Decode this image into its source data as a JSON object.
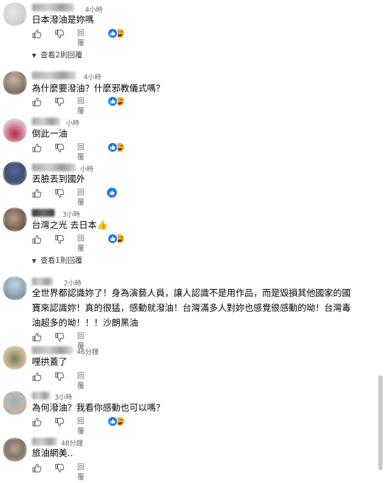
{
  "labels": {
    "reply": "回覆"
  },
  "comments": [
    {
      "time": "4小時",
      "text": "日本潑油是妳嗎"
    },
    {
      "time": "4小時",
      "text": "為什麼要潑油？什麼邪教儀式嗎？"
    },
    {
      "time": "小時",
      "text": "倒此一油"
    },
    {
      "time": "小時",
      "text": "丟臉丟到國外"
    },
    {
      "time": "3小時",
      "text": "台灣之光 去日本👍"
    },
    {
      "time": "2小時",
      "text_lines": [
        "全世界都認識妳了！身為演藝人員，讓人認識不是用作品，而是毀損其他國家的國",
        "寶來認識妳！真的很猛，感動就潑油！台灣滿多人對妳也感覺很感動的呦！台灣毒",
        "油超多的呦！！！沙朗黑油"
      ]
    },
    {
      "time": "46分鐘",
      "text": "哩拱蓋了"
    },
    {
      "time": "3小時",
      "text": "為何潑油？我看你感動也可以嗎？"
    },
    {
      "time": "48分鐘",
      "text": "旅油網美.."
    }
  ],
  "more_replies": [
    {
      "label": "查看2則回覆"
    },
    {
      "label": "查看1則回覆"
    }
  ],
  "colors": {
    "like_blue": "#1877f2",
    "haha_yellow": "#f7b125",
    "secondary_text": "#65676b"
  },
  "icons": {
    "like": "thumbs-up-icon",
    "dislike": "thumbs-down-icon",
    "reactions": "like-haha-reaction-icon",
    "expand": "chevron-down-icon"
  }
}
